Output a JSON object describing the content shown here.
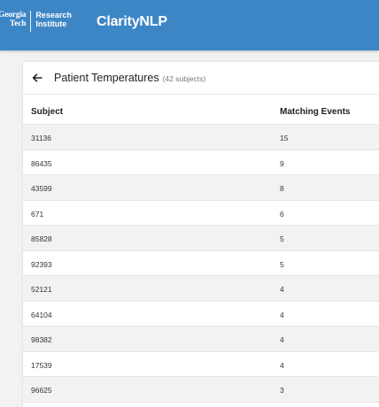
{
  "header": {
    "logo_line1": "Georgia",
    "logo_line2": "Tech",
    "logo_line3": "Research",
    "logo_line4": "Institute",
    "app_title": "ClarityNLP"
  },
  "page": {
    "back_icon": "arrow-left-icon",
    "title": "Patient Temperatures",
    "subject_count": "(42 subjects)"
  },
  "table": {
    "columns": [
      "Subject",
      "Matching Events"
    ],
    "rows": [
      {
        "subject": "31136",
        "events": "15"
      },
      {
        "subject": "86435",
        "events": "9"
      },
      {
        "subject": "43599",
        "events": "8"
      },
      {
        "subject": "671",
        "events": "6"
      },
      {
        "subject": "85828",
        "events": "5"
      },
      {
        "subject": "92393",
        "events": "5"
      },
      {
        "subject": "52121",
        "events": "4"
      },
      {
        "subject": "64104",
        "events": "4"
      },
      {
        "subject": "98382",
        "events": "4"
      },
      {
        "subject": "17539",
        "events": "4"
      },
      {
        "subject": "96625",
        "events": "3"
      }
    ]
  },
  "colors": {
    "topbar": "#3d86c6",
    "row_stripe": "#f2f2f2"
  }
}
